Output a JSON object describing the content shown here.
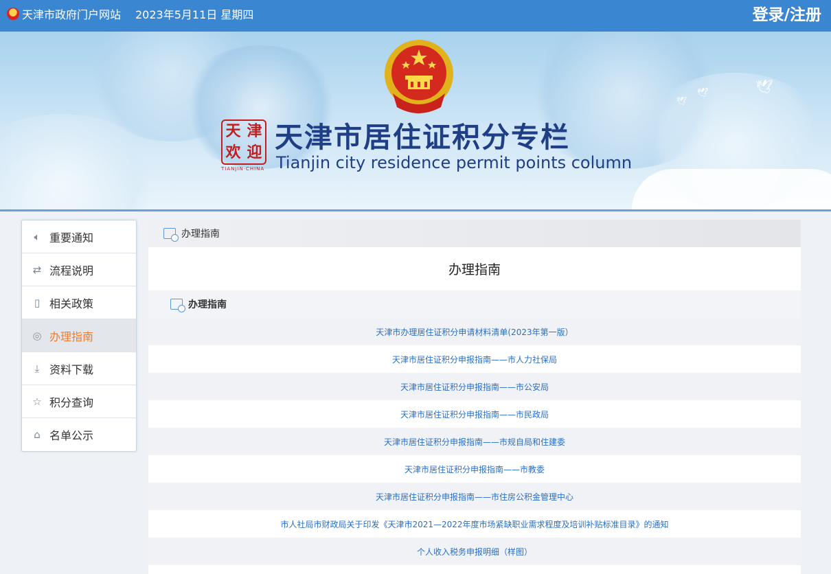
{
  "topbar": {
    "portal_link": "天津市政府门户网站",
    "date": "2023年5月11日 星期四",
    "auth": "登录/注册"
  },
  "banner": {
    "title_cn": "天津市居住证积分专栏",
    "title_en": "Tianjin city residence permit points column",
    "seal_chars": [
      "天",
      "津",
      "欢",
      "迎"
    ],
    "seal_caption": "TIANJIN·CHINA"
  },
  "sidebar": {
    "items": [
      {
        "label": "重要通知",
        "icon": "speaker-icon",
        "active": false
      },
      {
        "label": "流程说明",
        "icon": "flow-icon",
        "active": false
      },
      {
        "label": "相关政策",
        "icon": "book-icon",
        "active": false
      },
      {
        "label": "办理指南",
        "icon": "compass-icon",
        "active": true
      },
      {
        "label": "资料下载",
        "icon": "download-icon",
        "active": false
      },
      {
        "label": "积分查询",
        "icon": "star-icon",
        "active": false
      },
      {
        "label": "名单公示",
        "icon": "building-icon",
        "active": false
      }
    ]
  },
  "main": {
    "breadcrumb": "办理指南",
    "title": "办理指南",
    "section": "办理指南",
    "links": [
      "天津市办理居住证积分申请材料清单(2023年第一版）",
      "天津市居住证积分申报指南——市人力社保局",
      "天津市居住证积分申报指南——市公安局",
      "天津市居住证积分申报指南——市民政局",
      "天津市居住证积分申报指南——市规自局和住建委",
      "天津市居住证积分申报指南——市教委",
      "天津市居住证积分申报指南——市住房公积金管理中心",
      "市人社局市财政局关于印发《天津市2021—2022年度市场紧缺职业需求程度及培训补贴标准目录》的通知",
      "个人收入税务申报明细（样图）",
      ""
    ]
  },
  "colors": {
    "topbar": "#3a86d0",
    "active_text": "#f07c2c",
    "link": "#2b6fc2",
    "banner_title": "#1f3e86"
  }
}
